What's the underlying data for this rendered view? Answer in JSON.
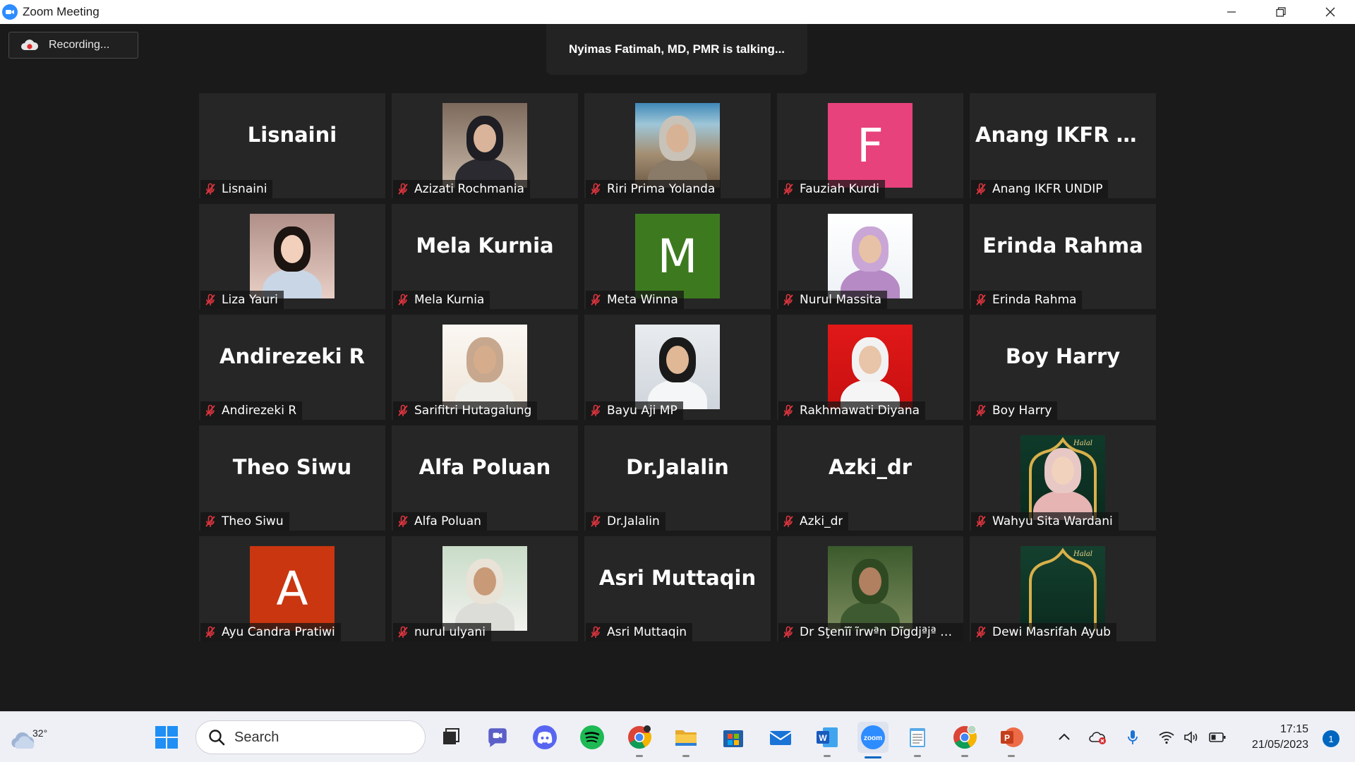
{
  "window": {
    "title": "Zoom Meeting"
  },
  "meeting": {
    "recording_label": "Recording...",
    "talking_banner": "Nyimas Fatimah, MD, PMR is talking..."
  },
  "participants": [
    {
      "display": "Lisnaini",
      "label": "Lisnaini",
      "type": "name"
    },
    {
      "display": "",
      "label": "Azizati Rochmania",
      "type": "photo",
      "photo": "woman-hijab-dark"
    },
    {
      "display": "",
      "label": "Riri Prima Yolanda",
      "type": "photo",
      "photo": "woman-landscape"
    },
    {
      "display": "F",
      "label": "Fauziah Kurdi",
      "type": "letter",
      "color": "#e8427c"
    },
    {
      "display": "Anang IKFR UN...",
      "label": "Anang IKFR UNDIP",
      "type": "name"
    },
    {
      "display": "",
      "label": "Liza Yauri",
      "type": "photo",
      "photo": "child"
    },
    {
      "display": "Mela Kurnia",
      "label": "Mela Kurnia",
      "type": "name"
    },
    {
      "display": "M",
      "label": "Meta Winna",
      "type": "letter",
      "color": "#3d7a1f"
    },
    {
      "display": "",
      "label": "Nurul Massita",
      "type": "photo",
      "photo": "woman-hijab-lilac"
    },
    {
      "display": "Erinda Rahma",
      "label": "Erinda Rahma",
      "type": "name"
    },
    {
      "display": "Andirezeki R",
      "label": "Andirezeki R",
      "type": "name"
    },
    {
      "display": "",
      "label": "Sarifitri Hutagalung",
      "type": "photo",
      "photo": "woman-hijab-beige"
    },
    {
      "display": "",
      "label": "Bayu Aji MP",
      "type": "photo",
      "photo": "man-coat"
    },
    {
      "display": "",
      "label": "Rakhmawati Diyana",
      "type": "photo",
      "photo": "woman-hijab-red"
    },
    {
      "display": "Boy Harry",
      "label": "Boy Harry",
      "type": "name"
    },
    {
      "display": "Theo Siwu",
      "label": "Theo Siwu",
      "type": "name"
    },
    {
      "display": "Alfa Poluan",
      "label": "Alfa Poluan",
      "type": "name"
    },
    {
      "display": "Dr.Jalalin",
      "label": "Dr.Jalalin",
      "type": "name"
    },
    {
      "display": "Azki_dr",
      "label": "Azki_dr",
      "type": "name"
    },
    {
      "display": "",
      "label": "Wahyu Sita Wardani",
      "type": "photo",
      "photo": "woman-halal-frame"
    },
    {
      "display": "A",
      "label": "Ayu Candra Pratiwi",
      "type": "letter",
      "color": "#c9360f"
    },
    {
      "display": "",
      "label": "nurul ulyani",
      "type": "photo",
      "photo": "woman-hijab-outdoor"
    },
    {
      "display": "Asri Muttaqin",
      "label": "Asri Muttaqin",
      "type": "name"
    },
    {
      "display": "",
      "label": "Dr Sţenĩĩ ĩrwªn Dĩgdjªjª S...",
      "type": "photo",
      "photo": "man-army"
    },
    {
      "display": "",
      "label": "Dewi Masrifah Ayub",
      "type": "photo",
      "photo": "halal-frame-empty"
    }
  ],
  "taskbar": {
    "weather_temp": "32°",
    "search_placeholder": "Search",
    "clock_time": "17:15",
    "clock_date": "21/05/2023",
    "notification_count": "1",
    "apps": [
      {
        "name": "start-icon"
      },
      {
        "name": "task-view-icon"
      },
      {
        "name": "teams-chat-icon"
      },
      {
        "name": "discord-icon"
      },
      {
        "name": "spotify-icon"
      },
      {
        "name": "chrome-icon"
      },
      {
        "name": "file-explorer-icon"
      },
      {
        "name": "microsoft-store-icon"
      },
      {
        "name": "mail-icon"
      },
      {
        "name": "word-icon"
      },
      {
        "name": "zoom-icon"
      },
      {
        "name": "notepad-icon"
      },
      {
        "name": "chrome-profile-icon"
      },
      {
        "name": "powerpoint-icon"
      }
    ]
  },
  "colors": {
    "tile_bg": "#262626",
    "meeting_bg": "#1a1a1a",
    "mute_red": "#e0353f",
    "zoom_blue": "#2d8cff"
  }
}
